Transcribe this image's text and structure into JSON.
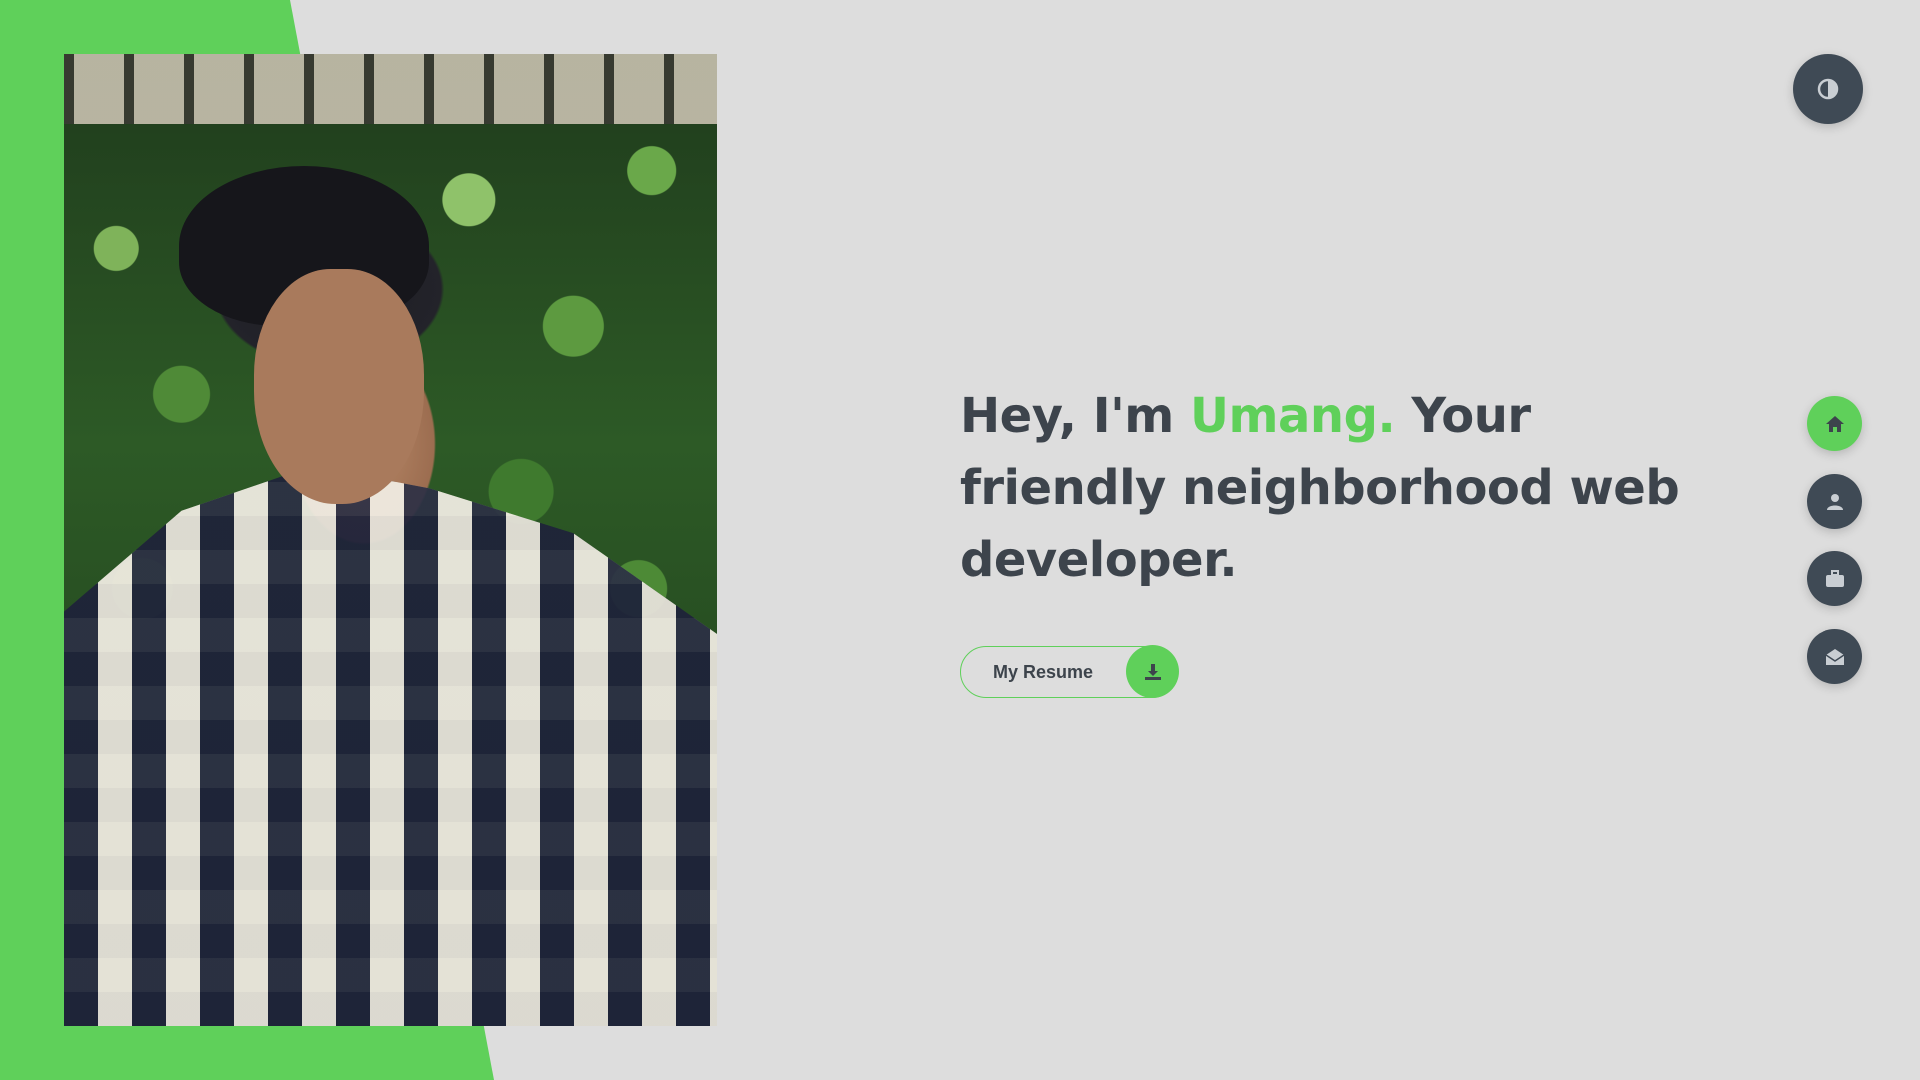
{
  "hero": {
    "greeting": "Hey, I'm",
    "name": "Umang.",
    "tagline": "Your friendly neighborhood web developer."
  },
  "resume_button": {
    "label": "My Resume",
    "icon": "download-icon"
  },
  "theme_toggle": {
    "icon": "contrast-icon"
  },
  "nav": [
    {
      "name": "home",
      "icon": "home-icon",
      "active": true
    },
    {
      "name": "about",
      "icon": "user-icon",
      "active": false
    },
    {
      "name": "portfolio",
      "icon": "briefcase-icon",
      "active": false
    },
    {
      "name": "contact",
      "icon": "envelope-open-icon",
      "active": false
    }
  ],
  "colors": {
    "accent": "#5fd05a",
    "background": "#dddddd",
    "text": "#3d444c",
    "button_dark": "#3f4a55"
  },
  "photo": {
    "alt": "profile-photo"
  }
}
